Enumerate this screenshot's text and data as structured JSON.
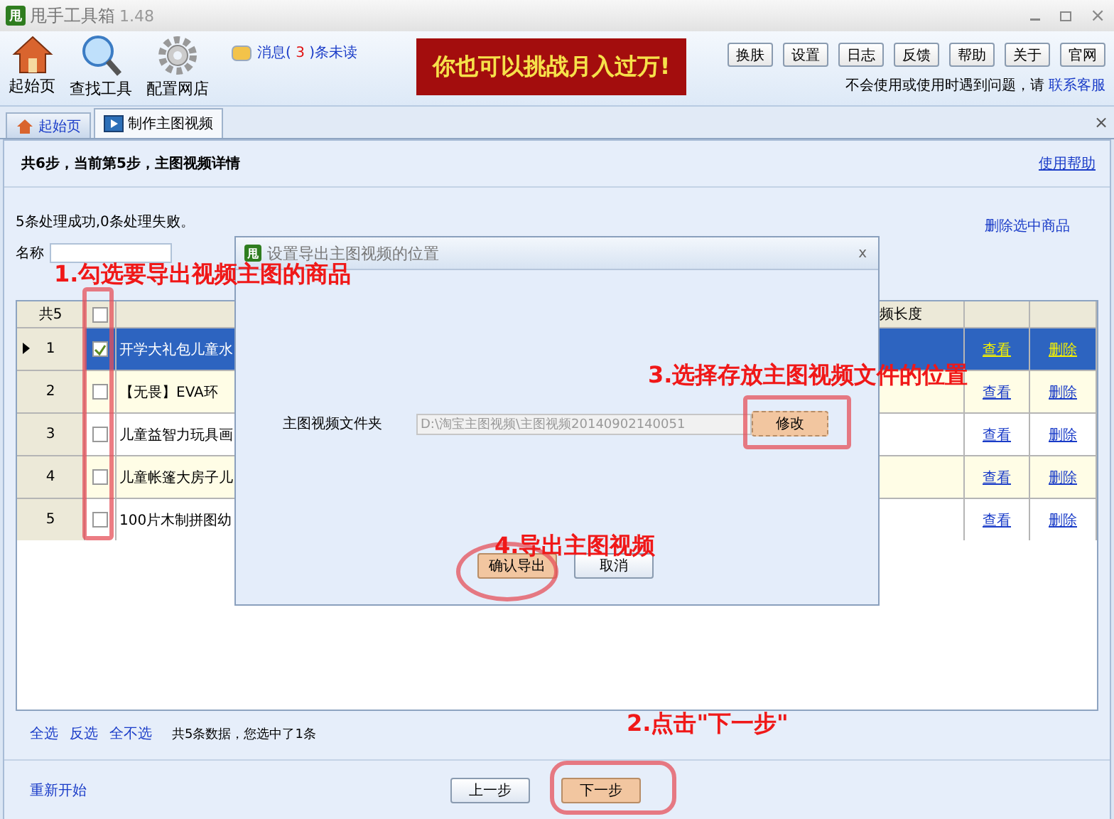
{
  "window": {
    "logo": "甩",
    "title": "甩手工具箱",
    "version": "1.48",
    "close": "×"
  },
  "toolbar": {
    "tools": [
      {
        "label": "起始页",
        "kind": "home"
      },
      {
        "label": "查找工具",
        "kind": "search"
      },
      {
        "label": "配置网店",
        "kind": "gear"
      }
    ],
    "messages": {
      "prefix": "消息(",
      "count": "3",
      "suffix": ")条未读"
    },
    "banner": "你也可以挑战月入过万!",
    "buttons": [
      "换肤",
      "设置",
      "日志",
      "反馈",
      "帮助",
      "关于",
      "官网"
    ],
    "help_text": "不会使用或使用时遇到问题，请",
    "help_link": "联系客服"
  },
  "tabs": [
    {
      "label": "起始页",
      "kind": "home",
      "selected": false
    },
    {
      "label": "制作主图视频",
      "kind": "film",
      "selected": true
    }
  ],
  "tab_close": "×",
  "step_header": "共6步，当前第5步，主图视频详情",
  "usage_help": "使用帮助",
  "result_text": "5条处理成功,0条处理失败。",
  "delete_selected": "删除选中商品",
  "filter": {
    "label": "名称"
  },
  "table": {
    "count_header": "共5",
    "all_checked": false,
    "length_header": "频长度",
    "rows": [
      {
        "index": "1",
        "selected": true,
        "checked": true,
        "name": "开学大礼包儿童水",
        "view": "查看",
        "delete": "删除"
      },
      {
        "index": "2",
        "selected": false,
        "checked": false,
        "name": "【无畏】EVA环",
        "view": "查看",
        "delete": "删除"
      },
      {
        "index": "3",
        "selected": false,
        "checked": false,
        "name": "儿童益智力玩具画",
        "view": "查看",
        "delete": "删除"
      },
      {
        "index": "4",
        "selected": false,
        "checked": false,
        "name": "儿童帐篷大房子儿",
        "view": "查看",
        "delete": "删除"
      },
      {
        "index": "5",
        "selected": false,
        "checked": false,
        "name": "100片木制拼图幼",
        "view": "查看",
        "delete": "删除"
      }
    ]
  },
  "footer": {
    "links": [
      "全选",
      "反选",
      "全不选"
    ],
    "summary": "共5条数据，您选中了1条"
  },
  "restart": "重新开始",
  "prev": "上一步",
  "next": "下一步",
  "dialog": {
    "logo": "甩",
    "title": "设置导出主图视频的位置",
    "close": "x",
    "field_label": "主图视频文件夹",
    "path": "D:\\淘宝主图视频\\主图视频20140902140051",
    "modify": "修改",
    "confirm": "确认导出",
    "cancel": "取消"
  },
  "annotations": {
    "select_items": "1.勾选要导出视频主图的商品",
    "click_next": "2.点击\"下一步\"",
    "choose_folder": "3.选择存放主图视频文件的位置",
    "export": "4.导出主图视频"
  }
}
